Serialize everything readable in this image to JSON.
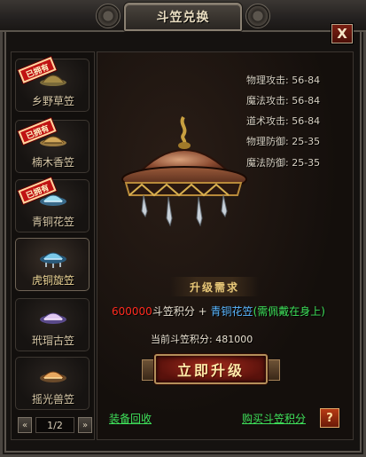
{
  "window": {
    "title": "斗笠兑换",
    "close_label": "X"
  },
  "items": [
    {
      "name": "乡野草笠",
      "stamp": "已拥有",
      "selected": false
    },
    {
      "name": "楠木香笠",
      "stamp": "已拥有",
      "selected": false
    },
    {
      "name": "青铜花笠",
      "stamp": "已拥有",
      "selected": false
    },
    {
      "name": "虎铜旋笠",
      "stamp": "",
      "selected": true
    },
    {
      "name": "玳瑁古笠",
      "stamp": "",
      "selected": false
    },
    {
      "name": "摇光兽笠",
      "stamp": "",
      "selected": false
    }
  ],
  "pager": {
    "prev_label": "«",
    "next_label": "»",
    "page_text": "1/2"
  },
  "stats": [
    {
      "label": "物理攻击: 56-84"
    },
    {
      "label": "魔法攻击: 56-84"
    },
    {
      "label": "道术攻击: 56-84"
    },
    {
      "label": "物理防御: 25-35"
    },
    {
      "label": "魔法防御: 25-35"
    }
  ],
  "requirement": {
    "header": "升级需求",
    "points_amount": "600000",
    "points_label": "斗笠积分",
    "plus": "+",
    "item": "青铜花笠",
    "note": "(需佩戴在身上)",
    "current": "当前斗笠积分: 481000"
  },
  "actions": {
    "upgrade": "立即升级",
    "recycle": "装备回收",
    "buy_points": "购买斗笠积分",
    "help": "?"
  },
  "colors": {
    "accent_red": "#ff2b1f",
    "item_blue": "#5ab6ff",
    "note_green": "#3ee05a"
  }
}
